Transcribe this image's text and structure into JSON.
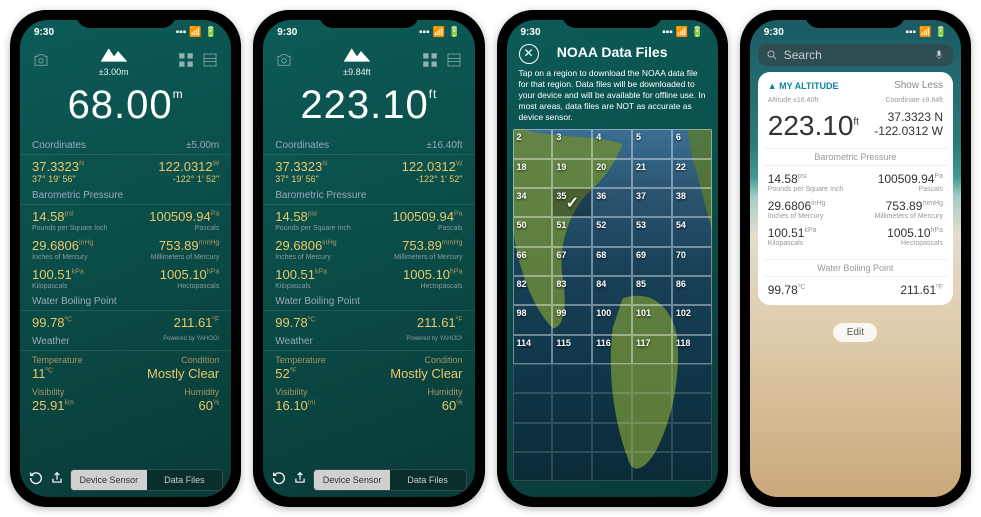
{
  "status_time": "9:30",
  "screens": [
    {
      "acc": "±3.00m",
      "alt": "68.00",
      "alt_unit": "m",
      "coord_head": "Coordinates",
      "coord_acc": "±5.00m",
      "lat": "37.3323",
      "lat_u": "N",
      "lat_dms": "37° 19' 56\"",
      "lon": "122.0312",
      "lon_u": "W",
      "lon_dms": "-122° 1' 52\"",
      "baro_head": "Barometric Pressure",
      "psi": "14.58",
      "psi_u": "psi",
      "psi_l": "Pounds per Square Inch",
      "pa": "100509.94",
      "pa_u": "Pa",
      "pa_l": "Pascals",
      "inhg": "29.6806",
      "inhg_u": "inHg",
      "inhg_l": "Inches of Mercury",
      "mmhg": "753.89",
      "mmhg_u": "mmHg",
      "mmhg_l": "Millimeters of Mercury",
      "kpa": "100.51",
      "kpa_u": "kPa",
      "kpa_l": "Kilopascals",
      "hpa": "1005.10",
      "hpa_u": "hPa",
      "hpa_l": "Hectopascals",
      "boil_head": "Water Boiling Point",
      "boil_c": "99.78",
      "boil_c_u": "ºC",
      "boil_f": "211.61",
      "boil_f_u": "ºF",
      "weather_head": "Weather",
      "yahoo": "Powered by YAHOO!",
      "temp_l": "Temperature",
      "temp": "11",
      "temp_u": "ºC",
      "cond_l": "Condition",
      "cond": "Mostly Clear",
      "vis_l": "Visibility",
      "vis": "25.91",
      "vis_u": "km",
      "hum_l": "Humidity",
      "hum": "60",
      "hum_u": "%",
      "seg1": "Device Sensor",
      "seg2": "Data Files"
    },
    {
      "acc": "±9.84ft",
      "alt": "223.10",
      "alt_unit": "ft",
      "coord_head": "Coordinates",
      "coord_acc": "±16.40ft",
      "lat": "37.3323",
      "lat_u": "N",
      "lat_dms": "37° 19' 56\"",
      "lon": "122.0312",
      "lon_u": "W",
      "lon_dms": "-122° 1' 52\"",
      "baro_head": "Barometric Pressure",
      "psi": "14.58",
      "psi_u": "psi",
      "psi_l": "Pounds per Square Inch",
      "pa": "100509.94",
      "pa_u": "Pa",
      "pa_l": "Pascals",
      "inhg": "29.6806",
      "inhg_u": "inHg",
      "inhg_l": "Inches of Mercury",
      "mmhg": "753.89",
      "mmhg_u": "mmHg",
      "mmhg_l": "Millimeters of Mercury",
      "kpa": "100.51",
      "kpa_u": "kPa",
      "kpa_l": "Kilopascals",
      "hpa": "1005.10",
      "hpa_u": "hPa",
      "hpa_l": "Hectopascals",
      "boil_head": "Water Boiling Point",
      "boil_c": "99.78",
      "boil_c_u": "ºC",
      "boil_f": "211.61",
      "boil_f_u": "ºF",
      "weather_head": "Weather",
      "yahoo": "Powered by YAHOO!",
      "temp_l": "Temperature",
      "temp": "52",
      "temp_u": "ºF",
      "cond_l": "Condition",
      "cond": "Mostly Clear",
      "vis_l": "Visibility",
      "vis": "16.10",
      "vis_u": "mi",
      "hum_l": "Humidity",
      "hum": "60",
      "hum_u": "%",
      "seg1": "Device Sensor",
      "seg2": "Data Files"
    }
  ],
  "noaa": {
    "title": "NOAA Data Files",
    "desc": "Tap on a region to download the NOAA data file for that region. Data files will be downloaded to your device and will be available for offline use. In most areas, data files are NOT as accurate as device sensor.",
    "selected": "35",
    "tiles": [
      "2",
      "3",
      "4",
      "5",
      "6",
      "18",
      "19",
      "20",
      "21",
      "22",
      "34",
      "35",
      "36",
      "37",
      "38",
      "50",
      "51",
      "52",
      "53",
      "54",
      "66",
      "67",
      "68",
      "69",
      "70",
      "82",
      "83",
      "84",
      "85",
      "86",
      "98",
      "99",
      "100",
      "101",
      "102",
      "114",
      "115",
      "116",
      "117",
      "118"
    ]
  },
  "widget": {
    "search": "Search",
    "app": "MY ALTITUDE",
    "show": "Show Less",
    "alt_l": "Altitude ±16.40ft",
    "coord_l": "Coordinate ±9.84ft",
    "alt": "223.10",
    "alt_u": "ft",
    "lat": "37.3323 N",
    "lon": "-122.0312 W",
    "baro": "Barometric Pressure",
    "psi": "14.58",
    "psi_u": "psi",
    "psi_l": "Pounds per Square Inch",
    "pa": "100509.94",
    "pa_u": "Pa",
    "pa_l": "Pascals",
    "inhg": "29.6806",
    "inhg_u": "inHg",
    "inhg_l": "Inches of Mercury",
    "mmhg": "753.89",
    "mmhg_u": "mmHg",
    "mmhg_l": "Millimeters of Mercury",
    "kpa": "100.51",
    "kpa_u": "kPa",
    "kpa_l": "Kilopascals",
    "hpa": "1005.10",
    "hpa_u": "hPa",
    "hpa_l": "Hectopascals",
    "boil": "Water Boiling Point",
    "boil_c": "99.78",
    "boil_c_u": "ºC",
    "boil_f": "211.61",
    "boil_f_u": "ºF",
    "edit": "Edit"
  }
}
